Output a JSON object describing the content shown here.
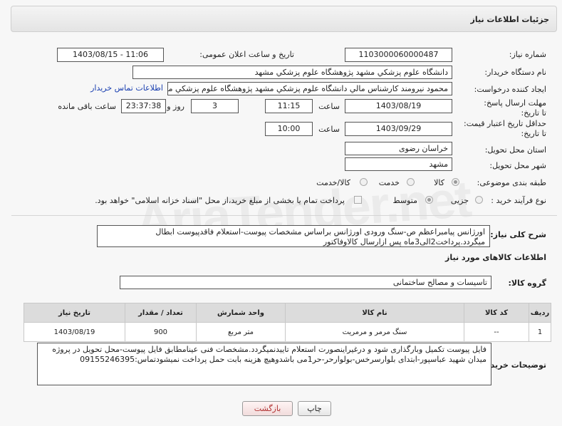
{
  "header": {
    "title": "جزئیات اطلاعات نیاز"
  },
  "fields": {
    "need_number_label": "شماره نیاز:",
    "need_number": "1103000060000487",
    "announce_label": "تاریخ و ساعت اعلان عمومی:",
    "announce_value": "1403/08/15 - 11:06",
    "buyer_org_label": "نام دستگاه خریدار:",
    "buyer_org": "دانشگاه علوم پزشکي مشهد   پژوهشگاه علوم پزشکي مشهد",
    "requester_label": "ایجاد کننده درخواست:",
    "requester": "محمود نيرومند کارشناس مالي دانشگاه علوم پزشکي مشهد   پژوهشگاه علوم پزشکي مشهد",
    "contact_link": "اطلاعات تماس خریدار",
    "deadline_label": "مهلت ارسال پاسخ: تا تاریخ:",
    "deadline_date": "1403/08/19",
    "time_label": "ساعت",
    "deadline_time": "11:15",
    "days": "3",
    "days_label": "روز و",
    "remaining": "23:37:38",
    "remaining_label": "ساعت باقی مانده",
    "validity_label": "حداقل تاریخ اعتبار قیمت: تا تاریخ:",
    "validity_date": "1403/09/29",
    "validity_time": "10:00",
    "province_label": "استان محل تحویل:",
    "province": "خراسان رضوی",
    "city_label": "شهر محل تحویل:",
    "city": "مشهد",
    "category_label": "طبقه بندی موضوعی:",
    "cat_options": [
      "کالا",
      "خدمت",
      "کالا/خدمت"
    ],
    "purchase_label": "نوع فرآیند خرید :",
    "purchase_options": [
      "جزیی",
      "متوسط"
    ],
    "treasury_note": "پرداخت تمام یا بخشی از مبلغ خرید،از محل \"اسناد خزانه اسلامی\" خواهد بود."
  },
  "description": {
    "label": "شرح کلی نیاز:",
    "text": "اورژانس پیامبراعظم ص-سنگ ورودی اورژانس براساس مشخصات پیوست-استعلام فاقدپیوست ابطال میگردد.پرداخت2الی3ماه پس ازارسال کالاوفاکتور"
  },
  "goods": {
    "section_title": "اطلاعات کالاهای مورد نیاز",
    "group_label": "گروه کالا:",
    "group_value": "تاسیسات و مصالح ساختمانی",
    "columns": [
      "ردیف",
      "کد کالا",
      "نام کالا",
      "واحد شمارش",
      "تعداد / مقدار",
      "تاریخ نیاز"
    ],
    "rows": [
      [
        "1",
        "--",
        "سنگ مرمر و مرمریت",
        "متر مربع",
        "900",
        "1403/08/19"
      ]
    ]
  },
  "buyer_notes": {
    "label": "توضیحات خریدار:",
    "text": "فایل پیوست تکمیل وبارگذاری شود و درغیراینصورت استعلام تاییدنمیگردد.مشخصات فنی عینامطابق فایل پیوست-محل تحویل در پروژه میدان شهید عباسپور-ابتدای بلوارسرخس-بولوارحر-حر1می باشدوهیچ هزینه بابت حمل  پرداخت نمیشودتماس:09155246395"
  },
  "buttons": {
    "print": "چاپ",
    "back": "بازگشت"
  },
  "watermark": "AriaTender.net"
}
